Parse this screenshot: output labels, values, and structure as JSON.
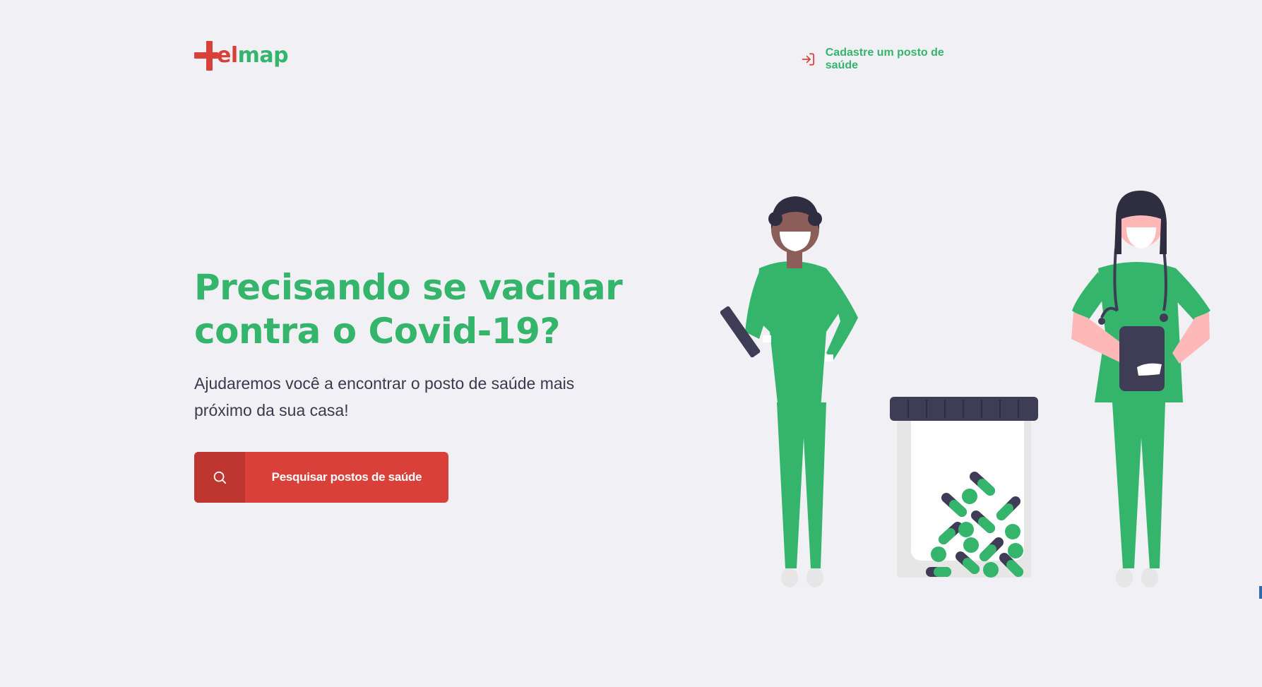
{
  "header": {
    "logo": {
      "prefix": "el",
      "suffix": "map",
      "cross_color": "#d9403a",
      "map_color": "#34b56b"
    },
    "register_link": {
      "label": "Cadastre um posto de saúde",
      "icon": "log-in-icon"
    }
  },
  "hero": {
    "title": "Precisando se vacinar contra o Covid-19?",
    "subtitle": "Ajudaremos você a encontrar o posto de saúde mais próximo da sua casa!",
    "search_button": {
      "label": "Pesquisar postos de saúde",
      "icon": "search-icon"
    }
  },
  "colors": {
    "background": "#f0f0f5",
    "primary_green": "#34b56b",
    "primary_red": "#d9403a",
    "dark_text": "#3a3a4a"
  },
  "illustration": {
    "subject": "two masked health workers and a jar of pills"
  }
}
